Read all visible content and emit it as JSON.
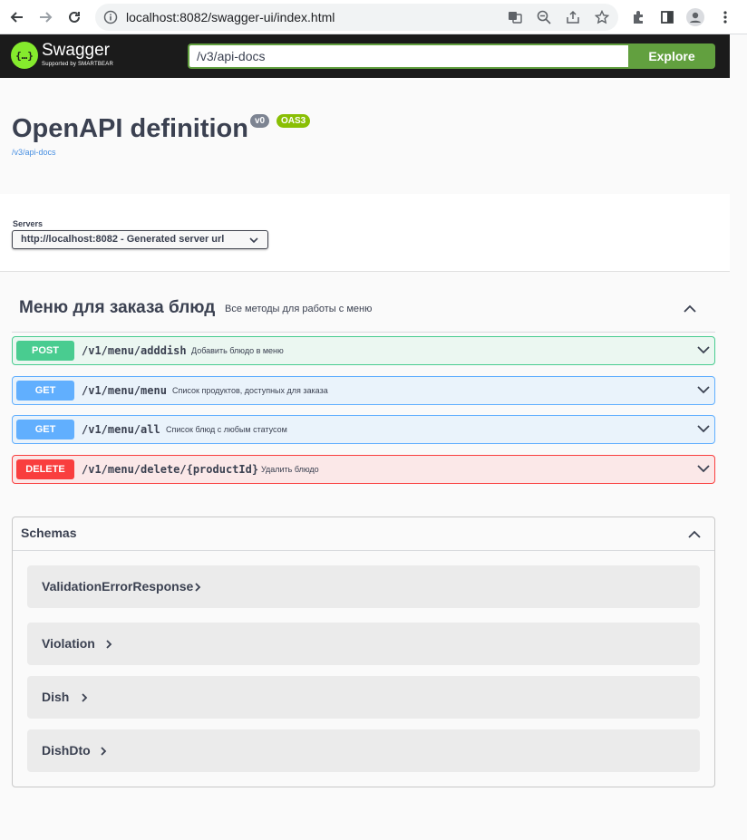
{
  "browser": {
    "url": "localhost:8082/swagger-ui/index.html"
  },
  "topbar": {
    "logo_title": "Swagger",
    "logo_sub": "Supported by SMARTBEAR",
    "logo_glyph": "{…}",
    "search_value": "/v3/api-docs",
    "explore_label": "Explore"
  },
  "info": {
    "title": "OpenAPI definition",
    "version_badge": "v0",
    "oas_badge": "OAS3",
    "link": "/v3/api-docs"
  },
  "servers": {
    "label": "Servers",
    "selected": "http://localhost:8082 - Generated server url"
  },
  "tag": {
    "name": "Меню для заказа блюд",
    "description": "Все методы для работы с меню"
  },
  "operations": [
    {
      "method": "POST",
      "path": "/v1/menu/adddish",
      "summary": "Добавить блюдо в меню"
    },
    {
      "method": "GET",
      "path": "/v1/menu/menu",
      "summary": "Список продуктов, доступных для заказа"
    },
    {
      "method": "GET",
      "path": "/v1/menu/all",
      "summary": "Список блюд с любым статусом"
    },
    {
      "method": "DELETE",
      "path": "/v1/menu/delete/{productId}",
      "summary": "Удалить блюдо"
    }
  ],
  "schemas": {
    "title": "Schemas",
    "models": [
      "ValidationErrorResponse",
      "Violation",
      "Dish",
      "DishDto"
    ]
  },
  "colors": {
    "post": "#49cc90",
    "get": "#61affe",
    "delete": "#f93e3e",
    "explore": "#62a03f",
    "swagger_green": "#85ea2d"
  }
}
